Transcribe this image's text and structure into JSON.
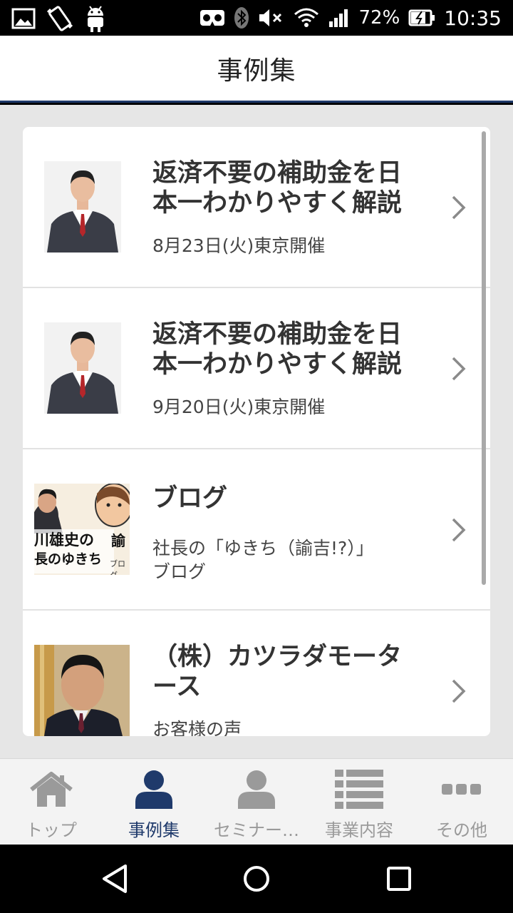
{
  "status_bar": {
    "battery_percent": "72%",
    "time": "10:35"
  },
  "header": {
    "title": "事例集"
  },
  "list": {
    "items": [
      {
        "title_line1": "返済不要の補助金を日",
        "title_line2": "本一わかりやすく解説",
        "subtitle_line1": "8月23日(火)東京開催",
        "subtitle_line2": "",
        "thumb_icon": "man-in-suit-photo"
      },
      {
        "title_line1": "返済不要の補助金を日",
        "title_line2": "本一わかりやすく解説",
        "subtitle_line1": "9月20日(火)東京開催",
        "subtitle_line2": "",
        "thumb_icon": "man-in-suit-photo"
      },
      {
        "title_line1": "ブログ",
        "title_line2": "",
        "subtitle_line1": "社長の「ゆきち（諭吉!?）」",
        "subtitle_line2": "ブログ",
        "thumb_icon": "blog-banner-photo",
        "thumb_text_line1": "川雄史の",
        "thumb_text_line2": "長のゆきち",
        "thumb_text_side": "諭",
        "thumb_text_small": "ブログ"
      },
      {
        "title_line1": "（株）カツラダモータ",
        "title_line2": "ース",
        "subtitle_line1": "お客様の声",
        "subtitle_line2": "",
        "thumb_icon": "customer-photo"
      }
    ]
  },
  "tabs": [
    {
      "label": "トップ",
      "icon": "home-icon",
      "active": false
    },
    {
      "label": "事例集",
      "icon": "person-icon",
      "active": true
    },
    {
      "label": "セミナー…",
      "icon": "person-icon",
      "active": false
    },
    {
      "label": "事業内容",
      "icon": "list-icon",
      "active": false
    },
    {
      "label": "その他",
      "icon": "more-icon",
      "active": false
    }
  ],
  "colors": {
    "accent": "#1f3a6b",
    "inactive": "#9a9a9a",
    "background": "#e6e6e6"
  }
}
